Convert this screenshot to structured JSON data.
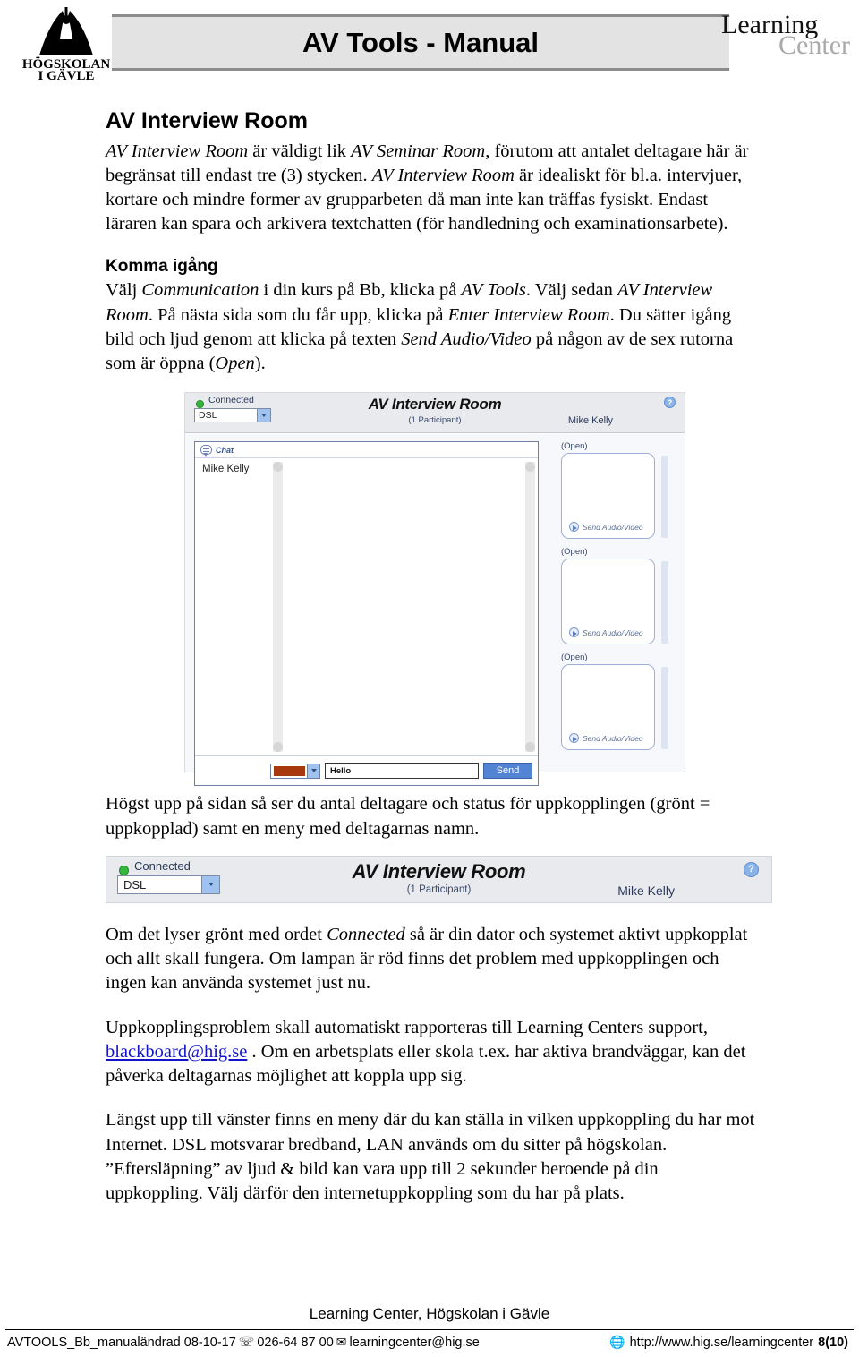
{
  "header": {
    "doc_title": "AV Tools - Manual",
    "logo_line1": "HÖGSKOLAN",
    "logo_line2": "I GÄVLE",
    "lc_learning": "Learning",
    "lc_center": "Center"
  },
  "content": {
    "section_heading": "AV Interview Room",
    "intro_paragraph": "AV Interview Room är väldigt lik AV Seminar Room, förutom att antalet deltagare här är begränsat till endast tre (3) stycken. AV Interview Room är idealiskt för bl.a. intervjuer, kortare och mindre former av grupparbeten då man inte kan träffas fysiskt. Endast läraren kan spara och arkivera textchatten (för handledning och examinationsarbete).",
    "intro_italic_1": "AV Interview Room",
    "intro_text_1": " är väldigt lik ",
    "intro_italic_2": "AV Seminar Room",
    "intro_text_2": ", förutom att antalet deltagare här är begränsat till endast tre (3) stycken. ",
    "intro_italic_3": "AV Interview Room",
    "intro_text_3": " är idealiskt för bl.a. intervjuer, kortare och mindre former av grupparbeten då man inte kan träffas fysiskt. Endast läraren kan spara och arkivera textchatten (för handledning och examinationsarbete).",
    "subheading_komma": "Komma igång",
    "komma_t1": "Välj ",
    "komma_i1": "Communication",
    "komma_t2": " i din kurs på Bb, klicka på ",
    "komma_i2": "AV Tools",
    "komma_t3": ". Välj sedan ",
    "komma_i3": "AV Interview Room",
    "komma_t4": ". På nästa sida som du får upp, klicka på ",
    "komma_i4": "Enter Interview Room",
    "komma_t5": ". Du sätter igång bild och ljud genom att klicka på texten ",
    "komma_i5": "Send Audio/Video",
    "komma_t6": " på någon av de sex rutorna som är öppna (",
    "komma_i6": "Open",
    "komma_t7": ").",
    "para_hogst": "Högst upp på sidan så ser du antal deltagare och status för uppkopplingen (grönt = uppkopplad) samt en meny med deltagarnas namn.",
    "para_om_t1": "Om det lyser grönt med ordet ",
    "para_om_i1": "Connected",
    "para_om_t2": " så är din dator och systemet aktivt uppkopplat och allt skall fungera. Om lampan är röd finns det problem med uppkopplingen och ingen kan använda systemet just nu.",
    "para_upp_t1": "Uppkopplingsproblem skall automatiskt rapporteras till Learning Centers support, ",
    "para_upp_link": "blackboard@hig.se",
    "para_upp_t2": " . Om en arbetsplats eller skola t.ex. har aktiva brandväggar, kan det påverka deltagarnas möjlighet att koppla upp sig.",
    "para_langst": "Längst upp till vänster finns en meny där du kan ställa in vilken uppkoppling du har mot Internet. DSL motsvarar bredband, LAN används om du sitter på högskolan. ”Eftersläpning” av ljud & bild kan vara upp till 2 sekunder beroende på din uppkoppling. Välj därför den internetuppkoppling som du har på plats."
  },
  "app_screenshot": {
    "status_label": "Connected",
    "connection_value": "DSL",
    "title": "AV Interview Room",
    "subtitle": "(1 Participant)",
    "user": "Mike Kelly",
    "help_glyph": "?",
    "chat_header": "Chat",
    "chat_entry": "Mike Kelly",
    "message_value": "Hello",
    "send_label": "Send",
    "color_swatch": "#a8390f",
    "video_slots": [
      {
        "label": "(Open)",
        "action": "Send Audio/Video"
      },
      {
        "label": "(Open)",
        "action": "Send Audio/Video"
      },
      {
        "label": "(Open)",
        "action": "Send Audio/Video"
      }
    ]
  },
  "app_screenshot_small": {
    "status_label": "Connected",
    "connection_value": "DSL",
    "title": "AV Interview Room",
    "subtitle": "(1 Participant)",
    "user": "Mike Kelly",
    "help_glyph": "?"
  },
  "footer": {
    "center_text": "Learning Center, Högskolan i Gävle",
    "doc_id": "AVTOOLS_Bb_manualändrad 08-10-17",
    "phone_icon": "☏",
    "phone": "026-64 87 00",
    "mail_icon": "✉",
    "email": "learningcenter@hig.se",
    "globe_icon": "🌐",
    "url": "http://www.hig.se/learningcenter",
    "page": "8(10)"
  }
}
